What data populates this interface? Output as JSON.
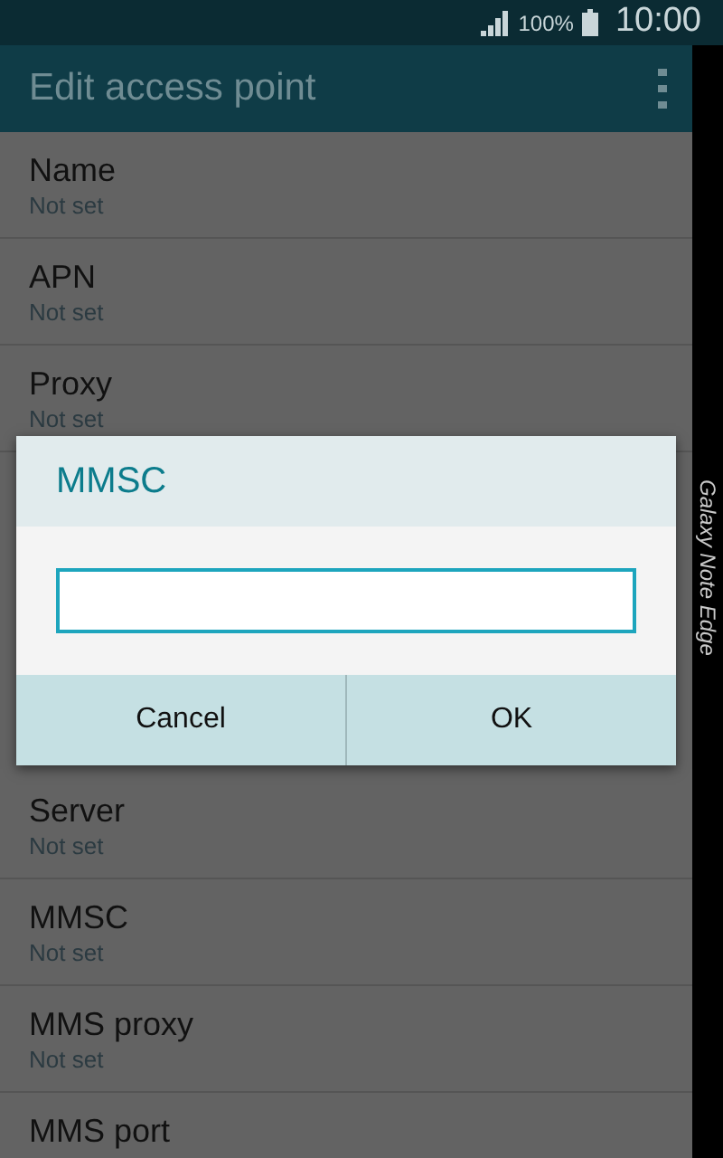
{
  "status_bar": {
    "battery": "100%",
    "time": "10:00"
  },
  "app_bar": {
    "title": "Edit access point"
  },
  "settings_above": [
    {
      "title": "Name",
      "value": "Not set"
    },
    {
      "title": "APN",
      "value": "Not set"
    },
    {
      "title": "Proxy",
      "value": "Not set"
    }
  ],
  "settings_below": [
    {
      "title": "Server",
      "value": "Not set"
    },
    {
      "title": "MMSC",
      "value": "Not set"
    },
    {
      "title": "MMS proxy",
      "value": "Not set"
    },
    {
      "title": "MMS port"
    }
  ],
  "dialog": {
    "title": "MMSC",
    "buttons": [
      "Cancel",
      "OK"
    ]
  },
  "edge_screen": {
    "label": "Galaxy Note Edge"
  }
}
